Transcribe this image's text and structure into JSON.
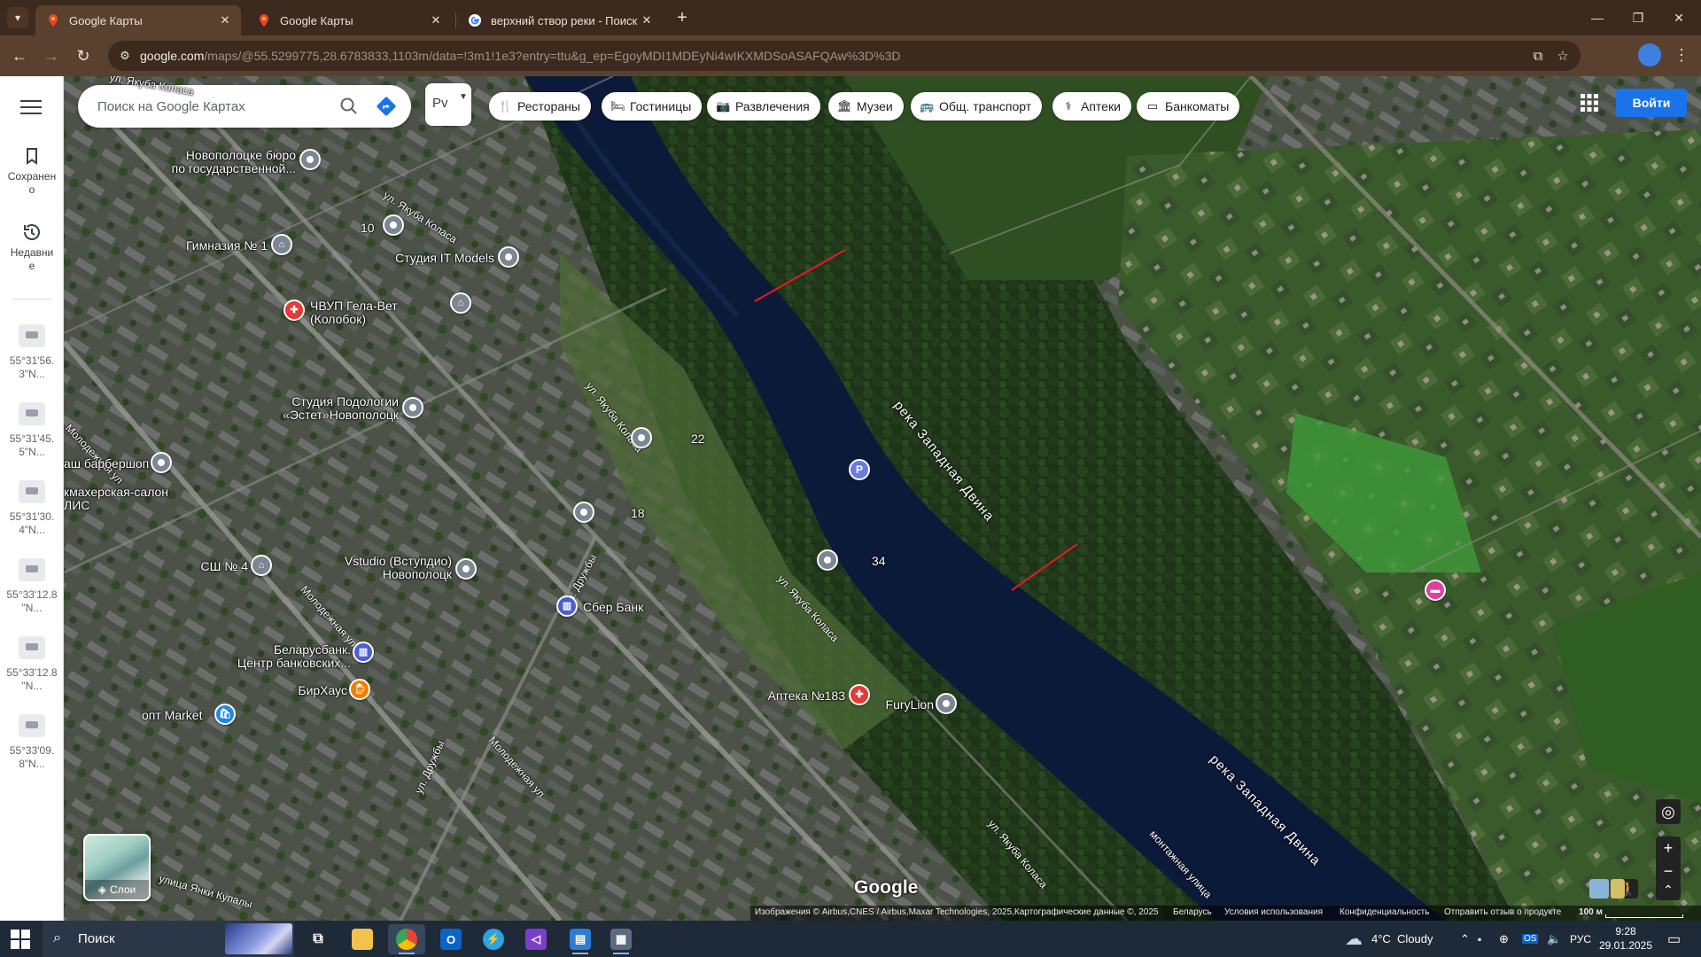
{
  "browser": {
    "tabs": [
      {
        "title": "Google Карты",
        "active": true
      },
      {
        "title": "Google Карты",
        "active": false
      },
      {
        "title": "верхний створ реки - Поиск в",
        "active": false
      }
    ],
    "url_host": "google.com",
    "url_path": "/maps/@55.5299775,28.6783833,1103m/data=!3m1!1e3?entry=ttu&g_ep=EgoyMDI1MDEyNi4wIKXMDSoASAFQAw%3D%3D"
  },
  "rail": {
    "saved_label": "Сохранен\nо",
    "recent_label": "Недавни\nе",
    "recent_items": [
      {
        "label": "55°31'56.\n3\"N..."
      },
      {
        "label": "55°31'45.\n5\"N..."
      },
      {
        "label": "55°31'30.\n4\"N..."
      },
      {
        "label": "55°33'12.8\n\"N..."
      },
      {
        "label": "55°33'12.8\n\"N..."
      },
      {
        "label": "55°33'09.\n8\"N..."
      }
    ]
  },
  "search": {
    "placeholder": "Поиск на Google Картах",
    "lang_chip": "Рv"
  },
  "chips": [
    {
      "label": "Рестораны",
      "icon": "fork-knife-icon"
    },
    {
      "label": "Гостиницы",
      "icon": "bed-icon"
    },
    {
      "label": "Развлечения",
      "icon": "camera-icon"
    },
    {
      "label": "Музеи",
      "icon": "museum-icon"
    },
    {
      "label": "Общ. транспорт",
      "icon": "bus-icon"
    },
    {
      "label": "Аптеки",
      "icon": "pharmacy-icon"
    },
    {
      "label": "Банкоматы",
      "icon": "atm-icon"
    }
  ],
  "signin_label": "Войти",
  "map": {
    "places": {
      "burau": "Новополоцке бюро\nпо государственной...",
      "b10": "10",
      "gymn": "Гимназия № 1",
      "itmodels": "Студия IT Models",
      "gela": "ЧВУП Гела-Вет\n(Колобок)",
      "podology": "Студия Подологии\n«Эстет»Новополоцк",
      "barber": "аш барбершоп",
      "salon": "кмахерская-салон\nЛИС",
      "b22": "22",
      "b18": "18",
      "b34": "34",
      "ssh4": "СШ № 4",
      "vstudio": "Vstudio (Вступдио)\nНовополоцк",
      "sber": "Сбер Банк",
      "belarusbank": "Беларусбанк.\nЦентр банковских...",
      "birhaus": "БирХаус",
      "market": "опт Market",
      "apteka": "Аптека №183",
      "furylion": "FuryLion"
    },
    "roads": {
      "yakuba1": "ул. Якуба Коласа",
      "yakuba2": "ул. Якуба Коласа",
      "yakuba3": "ул. Якуба Коласа",
      "yakuba4": "ул. Якуба Коласа",
      "molod1": "Молодежная ул",
      "molod2": "Молодежная ул",
      "molod3": "Молодежная ул",
      "druzhby1": "ул. Дружбы",
      "druzhby2": "ул. Дружбы",
      "kupaly": "улица Янки Купалы",
      "montazh": "монтажная улица"
    },
    "river_label": "река Западная Двина",
    "river_label2": "река Западная Двина",
    "parking": "P",
    "layers_label": "Слои",
    "logo": "Google",
    "attribution": "Изображения © Airbus,CNES / Airbus,Maxar Technologies, 2025,Картографические данные ©, 2025",
    "links": [
      "Беларусь",
      "Условия использования",
      "Конфиденциальность",
      "Отправить отзыв о продукте"
    ],
    "scale": "100 м"
  },
  "taskbar": {
    "search_label": "Поиск",
    "weather": "4°C  Cloudy",
    "lang": "РУС",
    "time": "9:28",
    "date": "29.01.2025"
  },
  "colors": {
    "accent": "#1a73e8",
    "annotation_line": "#e81b22",
    "river": "#0c1a3a"
  }
}
